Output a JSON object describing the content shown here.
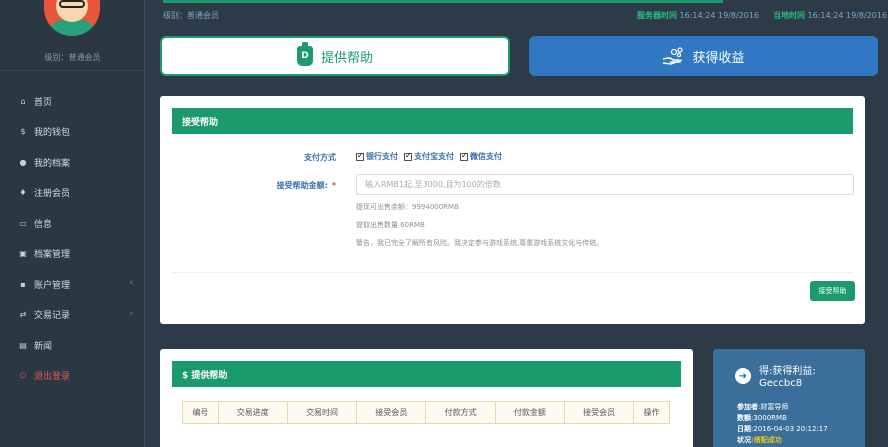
{
  "sidebar": {
    "level_text": "级别：普通会员",
    "items": [
      {
        "label": "首页",
        "icon": "home-icon",
        "glyph": "⌂",
        "chevron": false
      },
      {
        "label": "我的钱包",
        "icon": "dollar-icon",
        "glyph": "$",
        "chevron": false
      },
      {
        "label": "我的档案",
        "icon": "user-icon",
        "glyph": "●",
        "chevron": false
      },
      {
        "label": "注册会员",
        "icon": "person-icon",
        "glyph": "♦",
        "chevron": false
      },
      {
        "label": "信息",
        "icon": "folder-icon",
        "glyph": "▭",
        "chevron": false
      },
      {
        "label": "档案管理",
        "icon": "id-card-icon",
        "glyph": "▣",
        "chevron": false
      },
      {
        "label": "账户管理",
        "icon": "lock-icon",
        "glyph": "▪",
        "chevron": true
      },
      {
        "label": "交易记录",
        "icon": "exchange-icon",
        "glyph": "⇄",
        "chevron": true
      },
      {
        "label": "新闻",
        "icon": "news-icon",
        "glyph": "▤",
        "chevron": false
      },
      {
        "label": "退出登录",
        "icon": "power-icon",
        "glyph": "⏻",
        "chevron": false
      }
    ]
  },
  "topbar": {
    "level_text": "级别：普通会员",
    "server_time_label": "服务器时间",
    "server_time_value": "16:14:24 19/8/2016",
    "local_time_label": "当地时间",
    "local_time_value": "16:14:24 19/8/2016"
  },
  "actions": {
    "provide_help_label": "提供帮助",
    "get_income_label": "获得收益",
    "d_badge": "D"
  },
  "receive_panel": {
    "title": "接受帮助",
    "payment_label": "支付方式",
    "payment_options": [
      "银行支付",
      "支付宝支付",
      "微信支付"
    ],
    "amount_label": "接受帮助金额:",
    "required_mark": "*",
    "amount_placeholder": "输入RMB1起,至3000,且为100的倍数",
    "notes": [
      "提现可出售余额：9994000RMB",
      "提取出售数量 60RMB",
      "警告，我已完全了解所有风险。我决定参与游戏系统,尊重游戏系统文化与传统。"
    ],
    "submit_label": "接受帮助"
  },
  "offer_panel": {
    "title": "$ 提供帮助",
    "columns": [
      "编号",
      "交易进度",
      "交易时间",
      "接受会员",
      "付款方式",
      "付款金额",
      "接受会员",
      "操作"
    ]
  },
  "card": {
    "title_line1": "得:获得利益:",
    "title_line2": "Geccbc8",
    "participant_label": "参加者",
    "participant_value": ":财富导师",
    "amount_label": "数额",
    "amount_value": ":3000RMB",
    "date_label": "日期",
    "date_value": ":2016-04-03 20:12:17",
    "status_label": "状况",
    "status_value": ":搭配成功"
  },
  "colors": {
    "sidebar_bg": "#2b3743",
    "accent_green": "#1b9a6c",
    "accent_blue": "#3079c2",
    "card_blue": "#3a6f9c",
    "logout_red": "#e05a4e"
  }
}
